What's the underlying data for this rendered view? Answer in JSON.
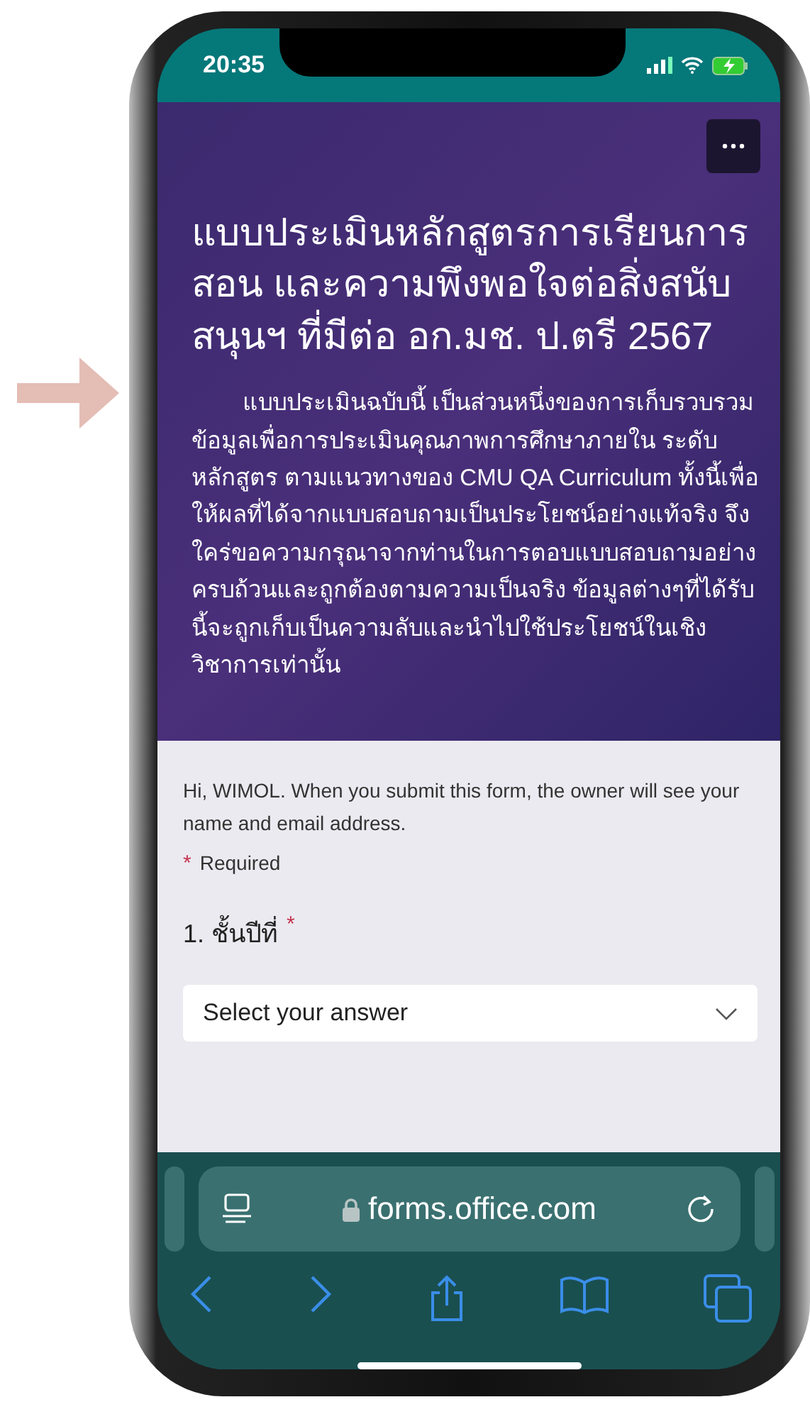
{
  "status_bar": {
    "time": "20:35"
  },
  "form_header": {
    "title": "แบบประเมินหลักสูตรการเรียนการสอน และความพึงพอใจต่อสิ่งสนับสนุนฯ ที่มีต่อ อก.มช. ป.ตรี 2567",
    "description": "แบบประเมินฉบับนี้ เป็นส่วนหนึ่งของการเก็บรวบรวมข้อมูลเพื่อการประเมินคุณภาพการศึกษาภายใน ระดับหลักสูตร ตามแนวทางของ CMU QA Curriculum  ทั้งนี้เพื่อให้ผลที่ได้จากแบบสอบถามเป็นประโยชน์อย่างแท้จริง จึงใคร่ขอความกรุณาจากท่านในการตอบแบบสอบถามอย่างครบถ้วนและถูกต้องตามความเป็นจริง ข้อมูลต่างๆที่ได้รับนี้จะถูกเก็บเป็นความลับและนำไปใช้ประโยชน์ในเชิงวิชาการเท่านั้น"
  },
  "form_body": {
    "notice": "Hi, WIMOL. When you submit this form, the owner will see your name and email address.",
    "required_mark": "*",
    "required_label": "Required",
    "questions": [
      {
        "label": "1. ชั้นปีที่",
        "mark": "*",
        "placeholder": "Select your answer"
      }
    ]
  },
  "browser_bar": {
    "url": "forms.office.com"
  }
}
